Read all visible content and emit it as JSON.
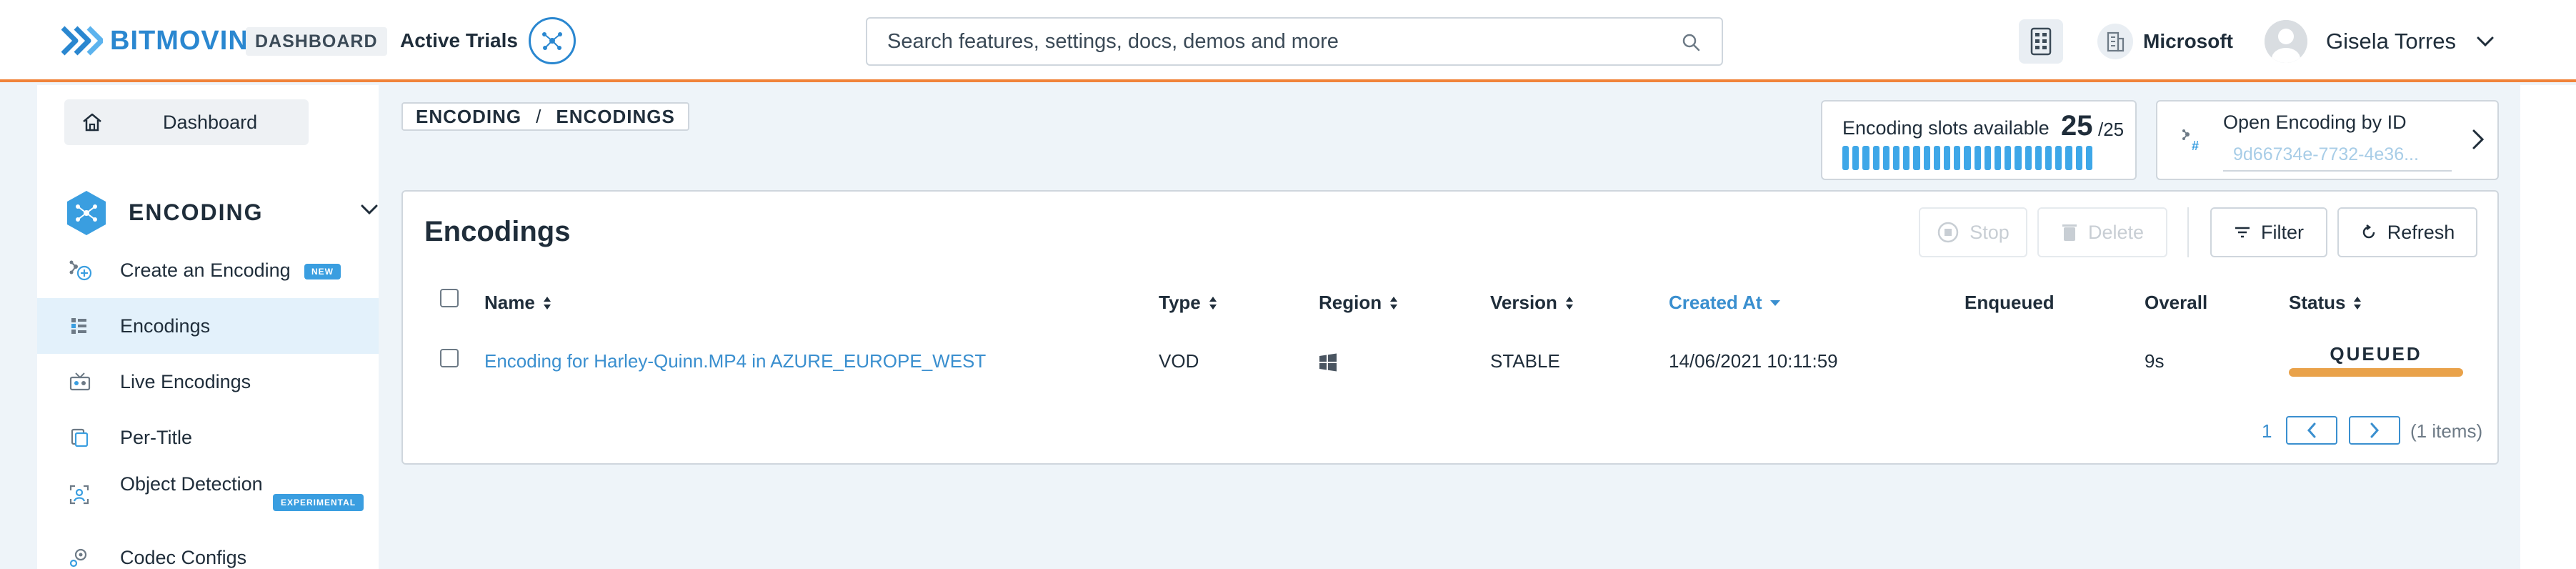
{
  "header": {
    "brand": "BITMOVIN",
    "dashboard_badge": "DASHBOARD",
    "active_trials": "Active Trials",
    "search_placeholder": "Search features, settings, docs, demos and more",
    "organization": "Microsoft",
    "user_name": "Gisela Torres",
    "accent_color": "#f0833a",
    "brand_color": "#2a87d0"
  },
  "sidebar": {
    "dashboard": "Dashboard",
    "section_title": "ENCODING",
    "items": [
      {
        "label": "Create an Encoding",
        "badge": "NEW",
        "icon": "create-encoding-icon"
      },
      {
        "label": "Encodings",
        "active": true,
        "icon": "encodings-list-icon"
      },
      {
        "label": "Live Encodings",
        "icon": "live-encodings-icon"
      },
      {
        "label": "Per-Title",
        "icon": "per-title-icon"
      },
      {
        "label": "Object Detection",
        "badge": "EXPERIMENTAL",
        "icon": "object-detection-icon"
      },
      {
        "label": "Codec Configs",
        "icon": "codec-configs-icon"
      }
    ]
  },
  "breadcrumb": {
    "part1": "ENCODING",
    "separator": "/",
    "part2": "ENCODINGS"
  },
  "slots": {
    "label": "Encoding slots available",
    "available": "25",
    "total": "/25",
    "fill_fraction": 1.0
  },
  "open_encoding": {
    "label": "Open Encoding by ID",
    "placeholder": "9d66734e-7732-4e36..."
  },
  "encodings": {
    "title": "Encodings",
    "buttons": {
      "stop": "Stop",
      "delete": "Delete",
      "filter": "Filter",
      "refresh": "Refresh"
    },
    "columns": {
      "name": "Name",
      "type": "Type",
      "region": "Region",
      "version": "Version",
      "created_at": "Created At",
      "enqueued": "Enqueued",
      "overall": "Overall",
      "status": "Status"
    },
    "rows": [
      {
        "name": "Encoding for Harley-Quinn.MP4 in AZURE_EUROPE_WEST",
        "type": "VOD",
        "region_icon": "windows-icon",
        "version": "STABLE",
        "created_at": "14/06/2021 10:11:59",
        "enqueued": "",
        "overall": "9s",
        "status": "QUEUED",
        "status_color": "#e9a24a"
      }
    ],
    "pagination": {
      "page": "1",
      "items": "(1 items)"
    }
  }
}
